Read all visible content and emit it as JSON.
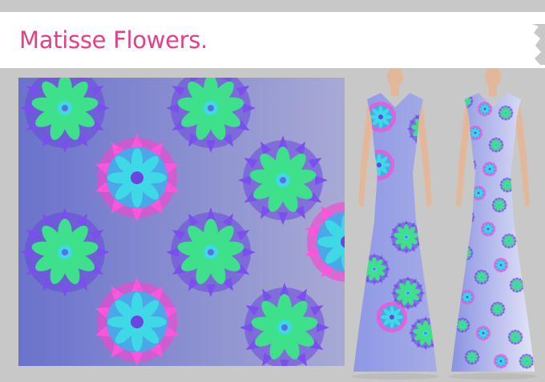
{
  "title": "Matisse Flowers.",
  "colors": {
    "title": "#e63f86",
    "background": "#c8c8c8",
    "banner": "#ffffff",
    "swatch_gradient_left": "#6a72cc",
    "swatch_gradient_right": "#a8aad4",
    "petal_green": "#3fe08c",
    "petal_purple": "#6b45e0",
    "petal_magenta": "#ff3fd0",
    "petal_cyan": "#3fd8e6"
  },
  "icons": {
    "pattern_motif": "flower-medallion-icon"
  }
}
